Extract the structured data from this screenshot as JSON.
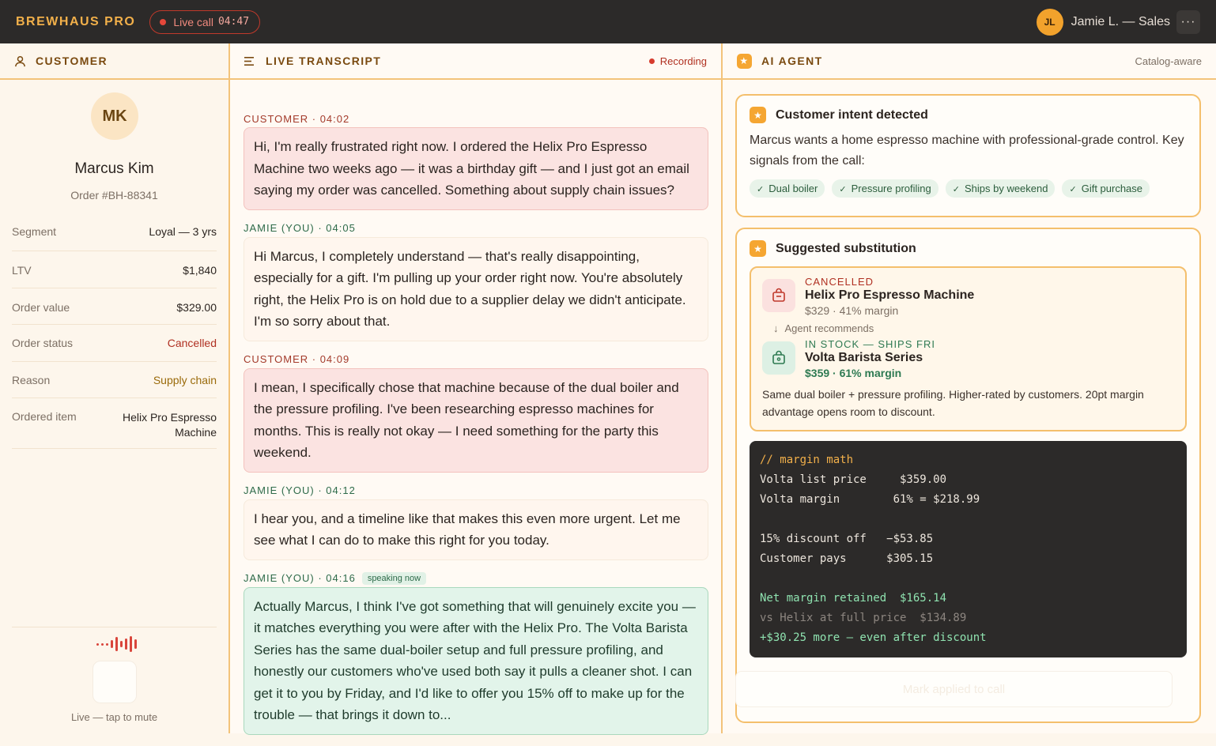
{
  "app": {
    "brand": "BREWHAUS PRO",
    "live_label": "Live call",
    "live_time": "04:47",
    "user_initials": "JL",
    "user_name": "Jamie L. — Sales",
    "more_label": "···"
  },
  "customer": {
    "header": "CUSTOMER",
    "initials": "MK",
    "name": "Marcus Kim",
    "order": "Order #BH-88341",
    "fields": [
      {
        "key": "Segment",
        "value": "Loyal — 3 yrs"
      },
      {
        "key": "LTV",
        "value": "$1,840"
      },
      {
        "key": "Order value",
        "value": "$329.00"
      },
      {
        "key": "Order status",
        "value": "Cancelled"
      },
      {
        "key": "Reason",
        "value": "Supply chain"
      },
      {
        "key": "Ordered item",
        "value": "Helix Pro Espresso Machine"
      }
    ],
    "mute_label": "Live — tap to mute"
  },
  "transcript": {
    "header": "LIVE TRANSCRIPT",
    "recording": "Recording",
    "messages": [
      {
        "speaker": "CUSTOMER · 04:02",
        "text": "Hi, I'm really frustrated right now. I ordered the Helix Pro Espresso Machine two weeks ago — it was a birthday gift — and I just got an email saying my order was cancelled. Something about supply chain issues?"
      },
      {
        "speaker": "JAMIE (YOU) · 04:05",
        "text": "Hi Marcus, I completely understand — that's really disappointing, especially for a gift. I'm pulling up your order right now. You're absolutely right, the Helix Pro is on hold due to a supplier delay we didn't anticipate. I'm so sorry about that."
      },
      {
        "speaker": "CUSTOMER · 04:09",
        "text": "I mean, I specifically chose that machine because of the dual boiler and the pressure profiling. I've been researching espresso machines for months. This is really not okay — I need something for the party this weekend."
      },
      {
        "speaker": "JAMIE (YOU) · 04:12",
        "text": "I hear you, and a timeline like that makes this even more urgent. Let me see what I can do to make this right for you today."
      },
      {
        "speaker": "JAMIE (YOU) · 04:16",
        "badge": "speaking now",
        "text": "Actually Marcus, I think I've got something that will genuinely excite you — it matches everything you were after with the Helix Pro. The Volta Barista Series has the same dual-boiler setup and full pressure profiling, and honestly our customers who've used both say it pulls a cleaner shot. I can get it to you by Friday, and I'd like to offer you 15% off to make up for the trouble — that brings it down to..."
      }
    ]
  },
  "agent": {
    "header": "AI AGENT",
    "catalog": "Catalog-aware",
    "intent": {
      "title": "Customer intent detected",
      "text": "Marcus wants a home espresso machine with professional-grade control. Key signals from the call:",
      "chips": [
        "Dual boiler",
        "Pressure profiling",
        "Ships by weekend",
        "Gift purchase"
      ]
    },
    "substitution": {
      "title": "Suggested substitution",
      "cancelled": {
        "status": "CANCELLED",
        "name": "Helix Pro Espresso Machine",
        "price": "$329",
        "margin": "41% margin"
      },
      "recommends": "Agent recommends",
      "instock": {
        "status": "IN STOCK — SHIPS FRI",
        "name": "Volta Barista Series",
        "price": "$359",
        "margin": "61% margin"
      },
      "note": "Same dual boiler + pressure profiling. Higher-rated by customers. 20pt margin advantage opens room to discount."
    },
    "math": {
      "comment": "// margin math",
      "l1": "Volta list price     $359.00",
      "l2": "Volta margin        61% = $218.99",
      "l3": "15% discount off   −$53.85",
      "l4": "Customer pays      $305.15",
      "l5": "Net margin retained  $165.14",
      "l6": "vs Helix at full price  $134.89",
      "l7": "+$30.25 more — even after discount"
    },
    "apply_label": "Mark applied to call"
  },
  "colors": {
    "accent": "#f5a632",
    "border": "#f3c37a",
    "danger": "#b03022",
    "success": "#2e7a52"
  }
}
